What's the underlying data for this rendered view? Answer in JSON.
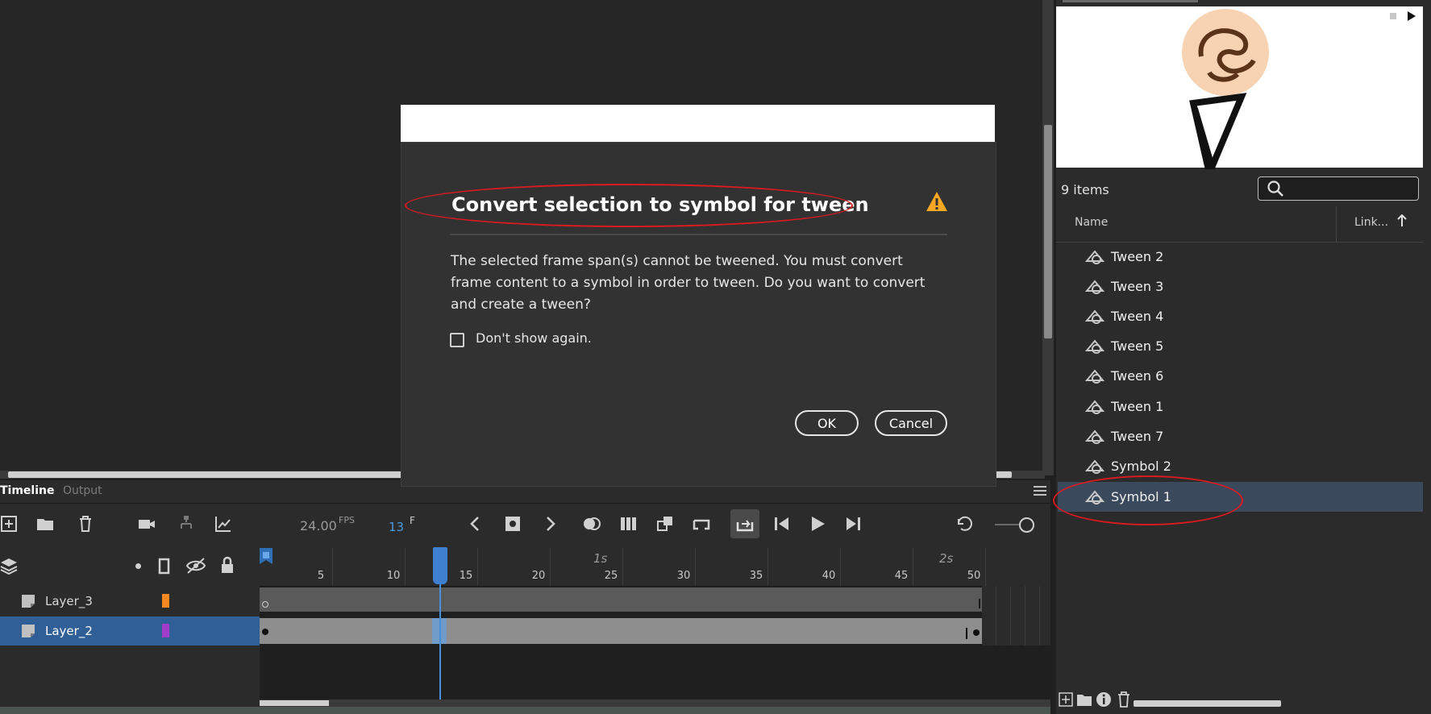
{
  "dialog": {
    "title": "Convert selection to symbol for tween",
    "body": "The selected frame span(s) cannot be tweened. You must convert frame content to a symbol in order to tween. Do you want to convert and create a tween?",
    "checkbox_label": "Don't show again.",
    "checkbox_checked": false,
    "ok_label": "OK",
    "cancel_label": "Cancel",
    "warning_icon": "warning-triangle-icon",
    "warning_color": "#f5a623"
  },
  "timeline": {
    "tabs": [
      {
        "label": "Timeline",
        "active": true
      },
      {
        "label": "Output",
        "active": false
      }
    ],
    "fps_value": "24.00",
    "fps_unit": "FPS",
    "frame_value": "13",
    "frame_unit": "F",
    "ruler_numbers": [
      "5",
      "10",
      "15",
      "20",
      "25",
      "30",
      "35",
      "40",
      "45",
      "50"
    ],
    "ruler_seconds": [
      "1s",
      "2s"
    ],
    "current_frame": 13,
    "total_frames": 50,
    "layers": [
      {
        "name": "Layer_3",
        "color": "#f5891f",
        "selected": false
      },
      {
        "name": "Layer_2",
        "color": "#a03cc8",
        "selected": true
      }
    ]
  },
  "library": {
    "count_label": "9 items",
    "column_name": "Name",
    "column_linkage": "Link...",
    "items": [
      {
        "label": "Tween 2",
        "selected": false
      },
      {
        "label": "Tween 3",
        "selected": false
      },
      {
        "label": "Tween 4",
        "selected": false
      },
      {
        "label": "Tween 5",
        "selected": false
      },
      {
        "label": "Tween 6",
        "selected": false
      },
      {
        "label": "Tween 1",
        "selected": false
      },
      {
        "label": "Tween 7",
        "selected": false
      },
      {
        "label": "Symbol 2",
        "selected": false
      },
      {
        "label": "Symbol 1",
        "selected": true
      }
    ]
  },
  "colors": {
    "accent_blue": "#2f6fb6",
    "playhead": "#4a90d9",
    "annotation_red": "#d91a20"
  }
}
